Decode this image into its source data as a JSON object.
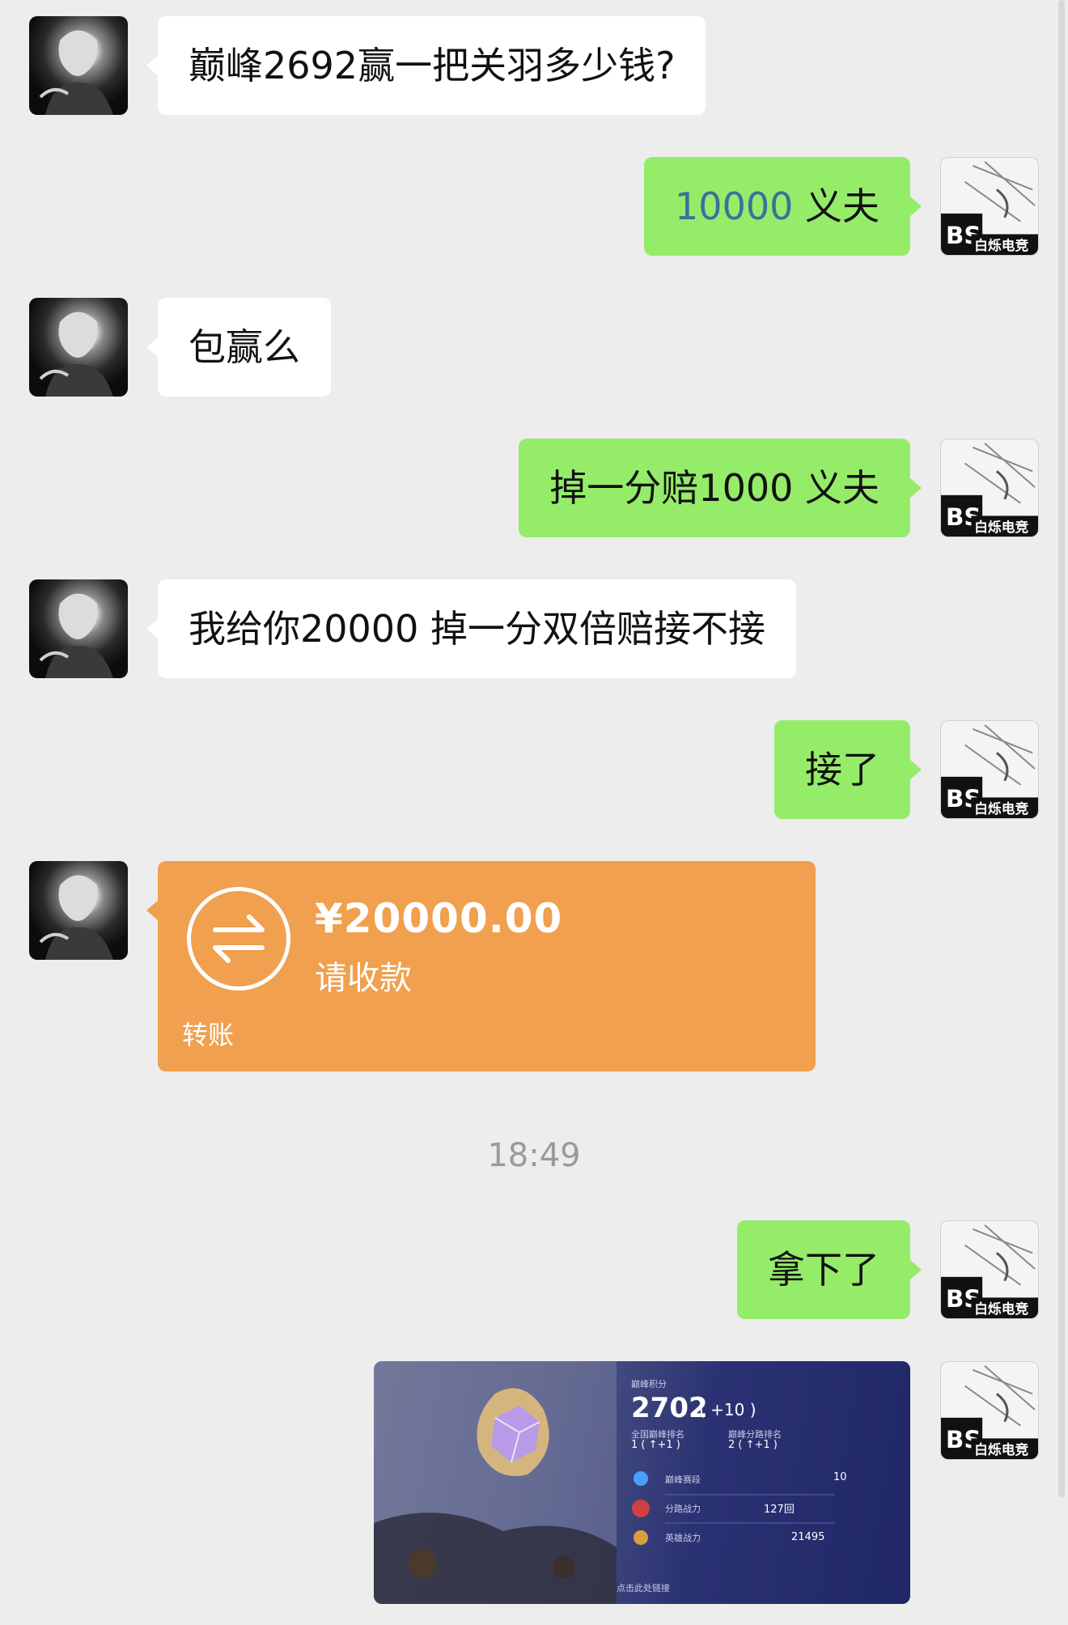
{
  "messages": [
    {
      "side": "left",
      "text": "巅峰2692赢一把关羽多少钱?"
    },
    {
      "side": "right",
      "text_number": "10000",
      "text_rest": " 义夫"
    },
    {
      "side": "left",
      "text": "包赢么"
    },
    {
      "side": "right",
      "text": "掉一分赔1000 义夫"
    },
    {
      "side": "left",
      "text": "我给你20000 掉一分双倍赔接不接"
    },
    {
      "side": "right",
      "text": "接了"
    },
    {
      "side": "right",
      "text": "拿下了"
    }
  ],
  "transfer": {
    "amount": "¥20000.00",
    "status": "请收款",
    "label": "转账",
    "icon": "transfer-arrows-icon"
  },
  "timestamp": "18:49",
  "screenshot": {
    "score_label": "巅峰积分",
    "score": "2702",
    "score_delta": "( +10 )",
    "national_rank_label": "全国巅峰排名",
    "national_rank": "1 ( ↑+1 )",
    "bracket_rank_label": "巅峰分路排名",
    "bracket_rank": "2 ( ↑+1 )",
    "row1_label": "巅峰赛段",
    "row1_value": "10",
    "row2_label": "分路战力",
    "row2_value": "127回",
    "row3_label": "英雄战力",
    "row3_value": "21495",
    "footer": "点击此处链接"
  },
  "avatars": {
    "left": "dark-anime-avatar",
    "right_brand": "BS",
    "right_text": "白烁电竞"
  },
  "colors": {
    "background": "#ededed",
    "bubble_left": "#ffffff",
    "bubble_right": "#95ec69",
    "transfer": "#f0a04e",
    "number_accent": "#3d6f9c"
  }
}
